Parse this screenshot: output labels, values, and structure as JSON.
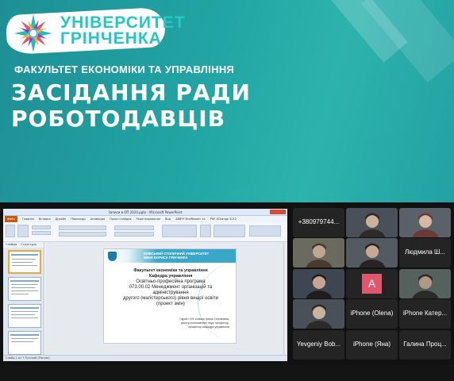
{
  "banner": {
    "logo_line1": "УНІВЕРСИТЕТ",
    "logo_line2": "ГРІНЧЕНКА",
    "faculty": "ФАКУЛЬТЕТ ЕКОНОМІКИ ТА УПРАВЛІННЯ",
    "headline": "ЗАСІДАННЯ РАДИ РОБОТОДАВЦІВ"
  },
  "colors": {
    "banner_teal": "#22a5a4",
    "logo_teal": "#25c7c5",
    "avatar_pink": "#e0566d"
  },
  "ppt": {
    "window_title": "Записи в ОП 2020.pptx - Microsoft PowerPoint",
    "tabs": [
      "Файл",
      "Главная",
      "Вставка",
      "Дизайн",
      "Переходы",
      "Анимация",
      "Показ слайдов",
      "Рецензирование",
      "Вид",
      "ABBYY FineReader 14",
      "PDF-XChange 2012"
    ],
    "panel_tabs": [
      "Слайды",
      "Структура"
    ],
    "status": "Слайд 1 из 7   Русский (Россия)",
    "slide": {
      "university": "КИЇВСЬКИЙ СТОЛИЧНИЙ УНІВЕРСИТЕТ\nІМЕНІ БОРИСА ГРІНЧЕНКА",
      "faculty": "Факультет економіки та управління",
      "department": "Кафедра управління",
      "program": "Освітньо-професійна програма",
      "code": "073.00.02 Менеджмент організацій та адміністрування",
      "level": "другого (магістерського) рівня вищої освіти",
      "project": "(проект змін)",
      "guarantor": "Гарант ОП: Коваль Ірина Степанівна,\nдоктор економічних наук, професор,\nпрофесор кафедри управління"
    }
  },
  "participants": [
    {
      "name": "+380979744...",
      "type": "name"
    },
    {
      "name": "",
      "type": "video",
      "icon": "participant-video"
    },
    {
      "name": "",
      "type": "video",
      "icon": "participant-video"
    },
    {
      "name": "",
      "type": "video",
      "icon": "participant-video"
    },
    {
      "name": "",
      "type": "video",
      "icon": "participant-video"
    },
    {
      "name": "Людмила Ш...",
      "type": "name"
    },
    {
      "name": "",
      "type": "video",
      "icon": "participant-video"
    },
    {
      "name": "A",
      "type": "avatar"
    },
    {
      "name": "",
      "type": "video",
      "icon": "participant-video"
    },
    {
      "name": "",
      "type": "video",
      "icon": "participant-video"
    },
    {
      "name": "iPhone (Olena)",
      "type": "name"
    },
    {
      "name": "iPhone Катер...",
      "type": "name"
    },
    {
      "name": "Yevgeniy Bob...",
      "type": "name"
    },
    {
      "name": "iPhone (Яна)",
      "type": "name"
    },
    {
      "name": "Галина Проц...",
      "type": "name"
    }
  ]
}
